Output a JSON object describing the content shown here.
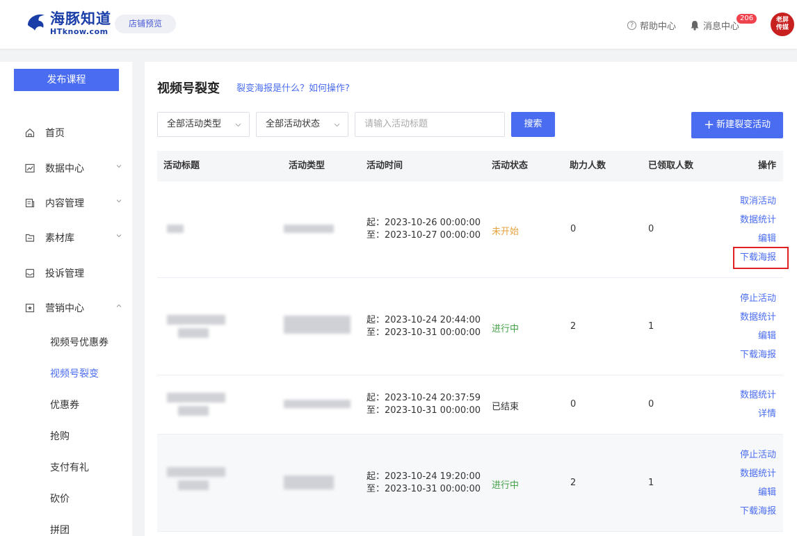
{
  "header": {
    "logo_cn": "海豚知道",
    "logo_en": "HTknow.com",
    "store_preview": "店铺预览",
    "help_center": "帮助中心",
    "messages": "消息中心",
    "message_count": "206",
    "avatar_text_1": "老屏",
    "avatar_text_2": "传媒"
  },
  "sidebar": {
    "publish": "发布课程",
    "items": [
      {
        "label": "首页"
      },
      {
        "label": "数据中心"
      },
      {
        "label": "内容管理"
      },
      {
        "label": "素材库"
      },
      {
        "label": "投诉管理"
      },
      {
        "label": "营销中心"
      }
    ],
    "sub_items": [
      {
        "label": "视频号优惠券"
      },
      {
        "label": "视频号裂变"
      },
      {
        "label": "优惠券"
      },
      {
        "label": "抢购"
      },
      {
        "label": "支付有礼"
      },
      {
        "label": "砍价"
      },
      {
        "label": "拼团"
      }
    ]
  },
  "main": {
    "title": "视频号裂变",
    "help_link": "裂变海报是什么？如何操作?",
    "filter_type": "全部活动类型",
    "filter_status": "全部活动状态",
    "search_placeholder": "请输入活动标题",
    "search_button": "搜索",
    "new_button": "新建裂变活动"
  },
  "table": {
    "columns": [
      "活动标题",
      "活动类型",
      "活动时间",
      "活动状态",
      "助力人数",
      "已领取人数",
      "操作"
    ],
    "rows": [
      {
        "start": "起：2023-10-26 00:00:00",
        "end": "至：2023-10-27 00:00:00",
        "status": "未开始",
        "status_color": "#e6a23c",
        "helpers": "0",
        "claimed": "0",
        "ops": [
          "取消活动",
          "数据统计",
          "编辑",
          "下载海报"
        ]
      },
      {
        "start": "起：2023-10-24 20:44:00",
        "end": "至：2023-10-31 00:00:00",
        "status": "进行中",
        "status_color": "#43a047",
        "helpers": "2",
        "claimed": "1",
        "ops": [
          "停止活动",
          "数据统计",
          "编辑",
          "下载海报"
        ]
      },
      {
        "start": "起：2023-10-24 20:37:59",
        "end": "至：2023-10-31 00:00:00",
        "status": "已结束",
        "status_color": "#333333",
        "helpers": "0",
        "claimed": "0",
        "ops": [
          "数据统计",
          "详情"
        ]
      },
      {
        "start": "起：2023-10-24 19:20:00",
        "end": "至：2023-10-31 00:00:00",
        "status": "进行中",
        "status_color": "#43a047",
        "helpers": "2",
        "claimed": "1",
        "ops": [
          "停止活动",
          "数据统计",
          "编辑",
          "下载海报"
        ]
      }
    ]
  },
  "colors": {
    "accent": "#4a6cf0",
    "highlight": "#e02020"
  }
}
